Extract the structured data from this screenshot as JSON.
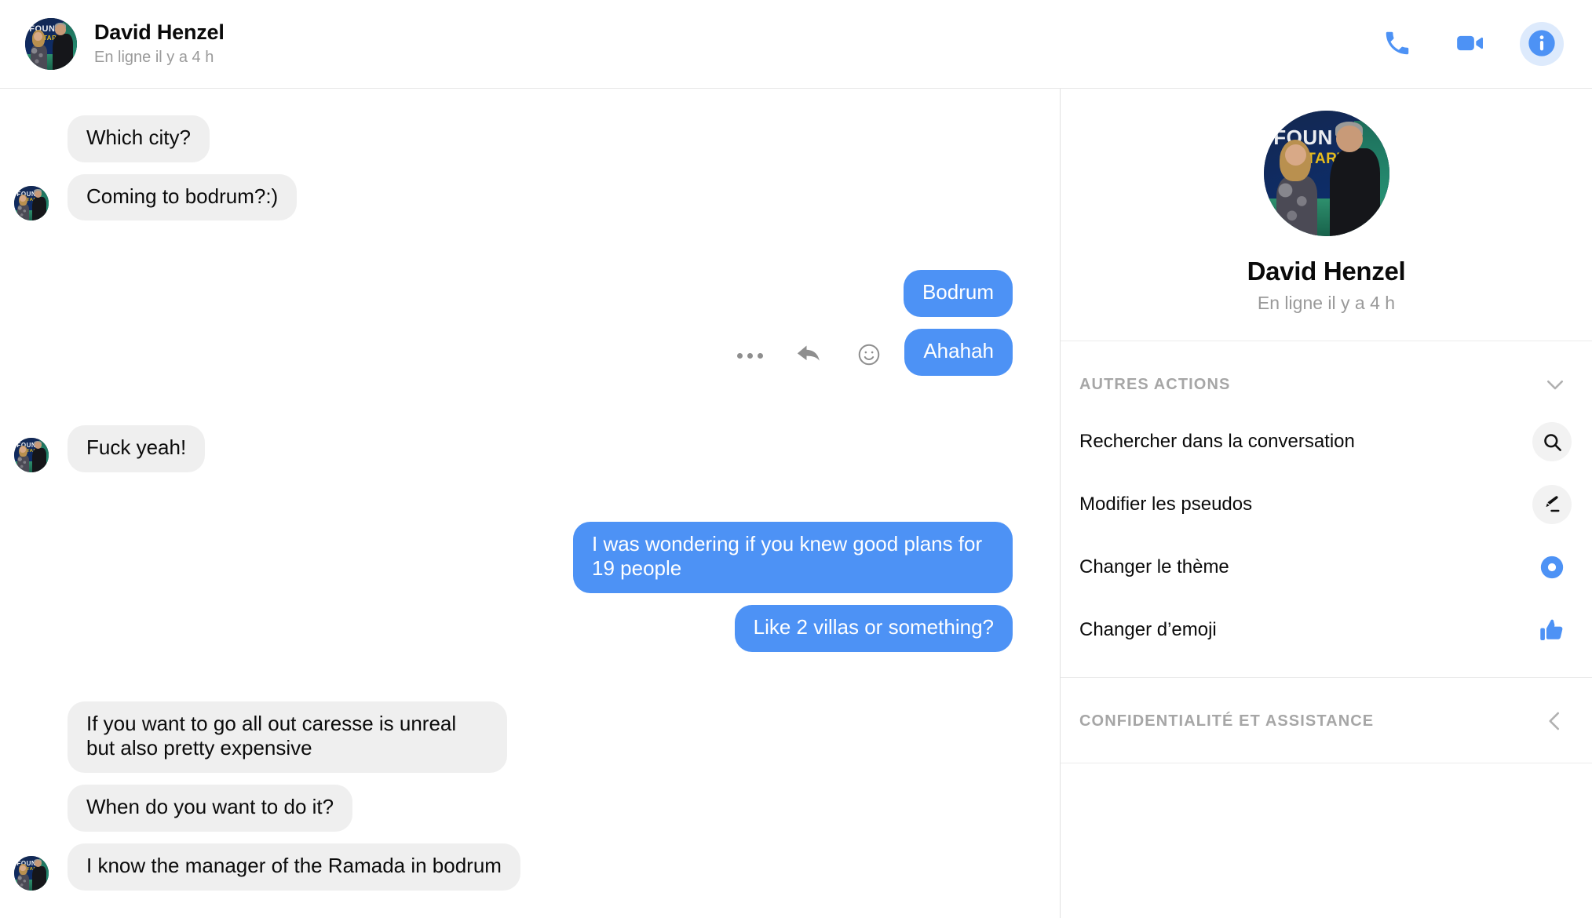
{
  "header": {
    "contact_name": "David Henzel",
    "status": "En ligne il y a 4 h",
    "actions": [
      {
        "name": "voice-call",
        "icon": "phone-icon"
      },
      {
        "name": "video-call",
        "icon": "video-camera-icon"
      },
      {
        "name": "conversation-info",
        "icon": "info-icon",
        "active": true
      }
    ]
  },
  "photo": {
    "banner_text_1": "FOUN",
    "banner_text_2": "START."
  },
  "messages": [
    {
      "direction": "in",
      "text": "Which city?",
      "show_avatar": false,
      "gap_before": "none"
    },
    {
      "direction": "in",
      "text": "Coming to bodrum?:)",
      "show_avatar": true,
      "gap_before": "sm"
    },
    {
      "direction": "out",
      "text": "Bodrum",
      "show_avatar": false,
      "gap_before": "lg"
    },
    {
      "direction": "out",
      "text": "Ahahah",
      "show_avatar": false,
      "gap_before": "sm",
      "hover_actions": true
    },
    {
      "direction": "in",
      "text": "Fuck yeah!",
      "show_avatar": true,
      "gap_before": "lg"
    },
    {
      "direction": "out",
      "text": "I was wondering if you knew good plans for 19 people",
      "show_avatar": false,
      "gap_before": "lg"
    },
    {
      "direction": "out",
      "text": "Like 2 villas or something?",
      "show_avatar": false,
      "gap_before": "sm"
    },
    {
      "direction": "in",
      "text": "If you want to go all out caresse is unreal but also pretty expensive",
      "show_avatar": false,
      "gap_before": "lg"
    },
    {
      "direction": "in",
      "text": "When do you want to do it?",
      "show_avatar": false,
      "gap_before": "sm"
    },
    {
      "direction": "in",
      "text": "I know the manager of the Ramada in bodrum",
      "show_avatar": true,
      "gap_before": "sm"
    }
  ],
  "hover_actions": [
    {
      "name": "more-options",
      "icon": "ellipsis-icon"
    },
    {
      "name": "reply",
      "icon": "reply-arrow-icon"
    },
    {
      "name": "react",
      "icon": "smiley-icon"
    }
  ],
  "sidebar": {
    "profile_name": "David Henzel",
    "profile_status": "En ligne il y a 4 h",
    "sections": [
      {
        "title": "AUTRES ACTIONS",
        "chevron": "chevron-down-icon",
        "expanded": true,
        "rows": [
          {
            "label": "Rechercher dans la conversation",
            "icon": "search-icon",
            "icon_style": "circle"
          },
          {
            "label": "Modifier les pseudos",
            "icon": "pencil-icon",
            "icon_style": "circle"
          },
          {
            "label": "Changer le thème",
            "icon": "theme-ring-icon",
            "icon_style": "plain"
          },
          {
            "label": "Changer d’emoji",
            "icon": "thumbs-up-icon",
            "icon_style": "plain"
          }
        ]
      },
      {
        "title": "CONFIDENTIALITÉ ET ASSISTANCE",
        "chevron": "chevron-left-icon",
        "expanded": false,
        "rows": []
      }
    ]
  },
  "colors": {
    "accent_blue": "#4d92f5",
    "incoming_bubble": "#efefef",
    "info_active_bg": "#ddeafc",
    "muted_text": "#9a9a9a"
  }
}
